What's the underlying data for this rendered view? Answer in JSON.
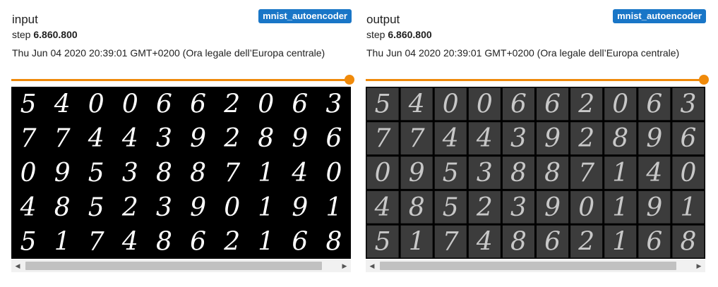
{
  "cards": [
    {
      "title": "input",
      "tag": "mnist_autoencoder",
      "step_label": "step",
      "step_value": "6.860.800",
      "date": "Thu Jun 04 2020 20:39:01 GMT+0200 (Ora legale dell’Europa centrale)",
      "slider_value": 1.0,
      "grid_style": "plain"
    },
    {
      "title": "output",
      "tag": "mnist_autoencoder",
      "step_label": "step",
      "step_value": "6.860.800",
      "date": "Thu Jun 04 2020 20:39:01 GMT+0200 (Ora legale dell’Europa centrale)",
      "slider_value": 1.0,
      "grid_style": "reconstructed"
    }
  ],
  "digit_grid": [
    [
      "5",
      "4",
      "0",
      "0",
      "6",
      "6",
      "2",
      "0",
      "6",
      "3"
    ],
    [
      "7",
      "7",
      "4",
      "4",
      "3",
      "9",
      "2",
      "8",
      "9",
      "6"
    ],
    [
      "0",
      "9",
      "5",
      "3",
      "8",
      "8",
      "7",
      "1",
      "4",
      "0"
    ],
    [
      "4",
      "8",
      "5",
      "2",
      "3",
      "9",
      "0",
      "1",
      "9",
      "1"
    ],
    [
      "5",
      "1",
      "7",
      "4",
      "8",
      "6",
      "2",
      "1",
      "6",
      "8"
    ]
  ],
  "icons": {
    "scroll_left": "chevron-left-icon",
    "scroll_right": "chevron-right-icon"
  },
  "colors": {
    "tag_bg": "#1976c7",
    "slider": "#f08a0a"
  }
}
